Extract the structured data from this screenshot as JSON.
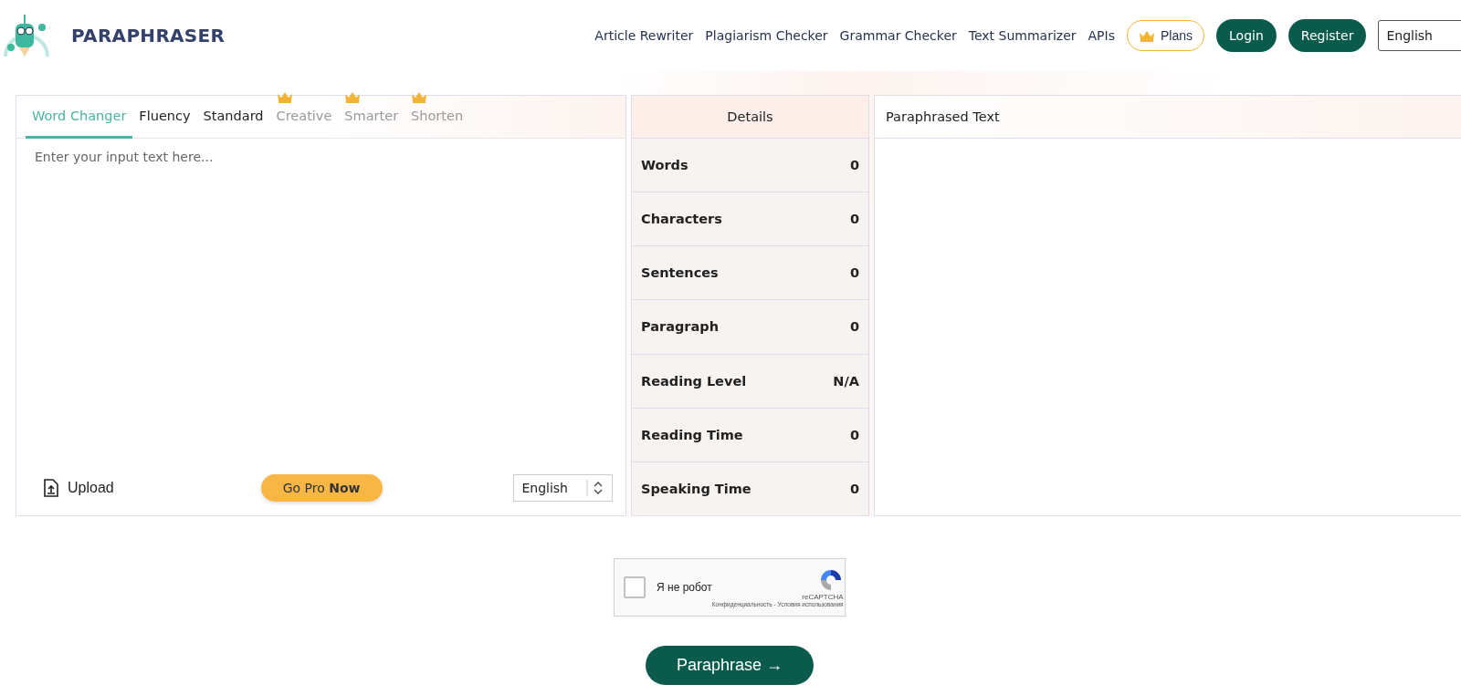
{
  "header": {
    "logo": "PARAPHRASER",
    "nav": [
      "Article Rewriter",
      "Plagiarism Checker",
      "Grammar Checker",
      "Text Summarizer",
      "APIs"
    ],
    "plans": "Plans",
    "login": "Login",
    "register": "Register",
    "language": "English"
  },
  "input_panel": {
    "tabs": [
      {
        "label": "Word Changer",
        "selected": true,
        "premium": false
      },
      {
        "label": "Fluency",
        "selected": false,
        "premium": false
      },
      {
        "label": "Standard",
        "selected": false,
        "premium": false
      },
      {
        "label": "Creative",
        "selected": false,
        "premium": true
      },
      {
        "label": "Smarter",
        "selected": false,
        "premium": true
      },
      {
        "label": "Shorten",
        "selected": false,
        "premium": true
      }
    ],
    "placeholder": "Enter your input text here...",
    "upload": "Upload",
    "go_pro": "Go Pro **Now**",
    "language": "English"
  },
  "details": {
    "title": "Details",
    "rows": [
      {
        "label": "Words",
        "value": "0"
      },
      {
        "label": "Characters",
        "value": "0"
      },
      {
        "label": "Sentences",
        "value": "0"
      },
      {
        "label": "Paragraph",
        "value": "0"
      },
      {
        "label": "Reading Level",
        "value": "N/A"
      },
      {
        "label": "Reading Time",
        "value": "0"
      },
      {
        "label": "Speaking Time",
        "value": "0"
      }
    ]
  },
  "output_panel": {
    "title": "Paraphrased Text"
  },
  "captcha": {
    "label": "Я не робот",
    "checked": false,
    "brand": "reCAPTCHA",
    "terms": "Конфиденциальность - Условия использования"
  },
  "paraphrase_button": "Paraphrase →"
}
